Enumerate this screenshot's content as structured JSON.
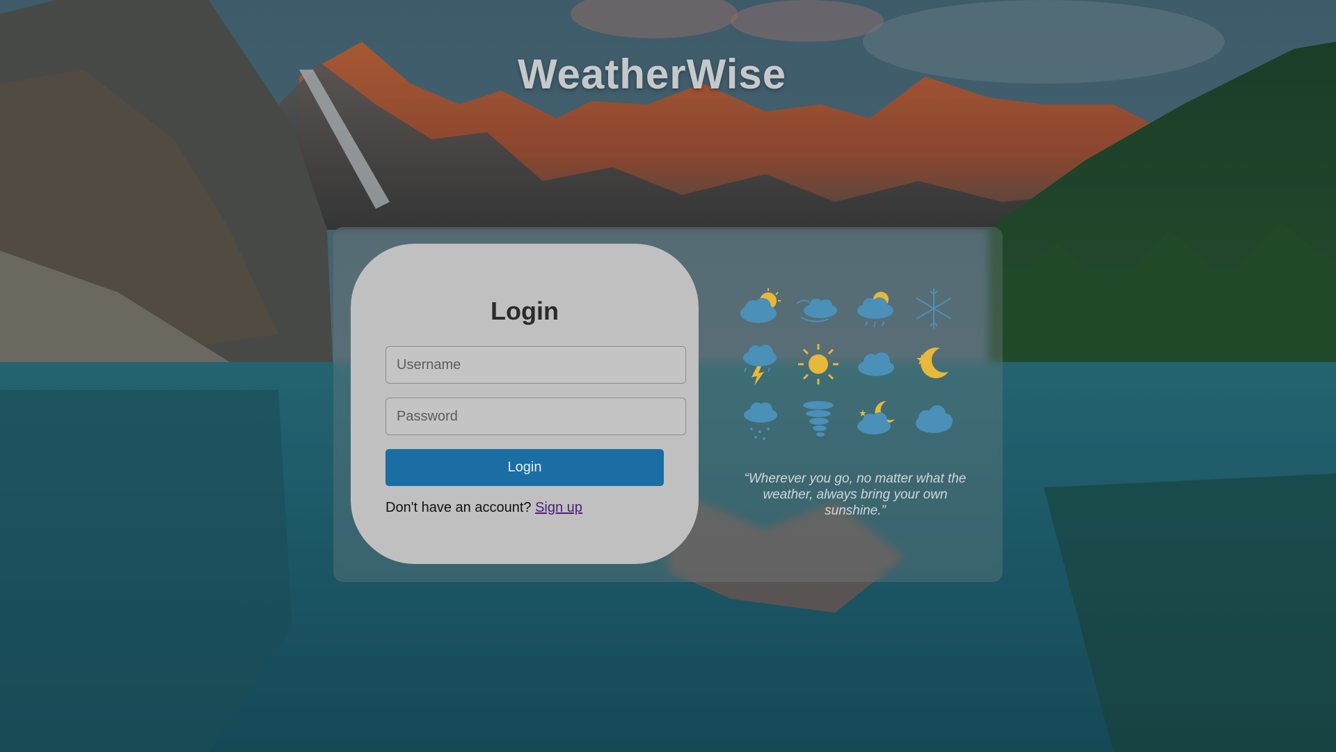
{
  "app": {
    "title": "WeatherWise"
  },
  "login": {
    "heading": "Login",
    "username_placeholder": "Username",
    "password_placeholder": "Password",
    "button_label": "Login",
    "signup_prompt": "Don't have an account?",
    "signup_link": "Sign up"
  },
  "quote": {
    "text": "“Wherever you go, no matter what the weather, always bring your own sunshine.”"
  },
  "weather_icons": [
    "partly-sunny-cloud-icon",
    "windy-cloud-icon",
    "sun-rain-cloud-icon",
    "snowflake-icon",
    "thunderstorm-icon",
    "sun-icon",
    "cloud-icon",
    "moon-stars-icon",
    "snow-cloud-icon",
    "tornado-icon",
    "night-cloud-icon",
    "fog-cloud-icon"
  ],
  "colors": {
    "card_background": "#c0c0c0",
    "button_color": "#1a6ea3",
    "link_color": "#4a1d7a",
    "icon_blue": "#4a90b8",
    "icon_yellow": "#e8b83a"
  }
}
